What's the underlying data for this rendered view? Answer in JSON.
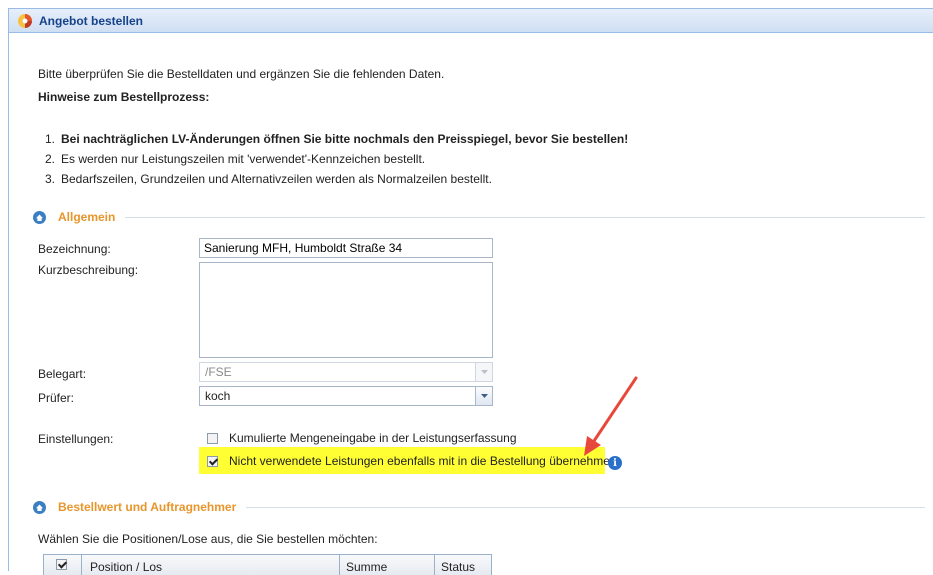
{
  "window": {
    "title": "Angebot bestellen"
  },
  "intro": {
    "text": "Bitte überprüfen Sie die Bestelldaten und ergänzen Sie die fehlenden Daten.",
    "hint_heading": "Hinweise zum Bestellprozess:",
    "hints": [
      {
        "num": "1.",
        "text": "Bei nachträglichen LV-Änderungen öffnen Sie bitte nochmals den Preisspiegel, bevor Sie bestellen!",
        "bold": true
      },
      {
        "num": "2.",
        "text": "Es werden nur Leistungszeilen mit 'verwendet'-Kennzeichen bestellt.",
        "bold": false
      },
      {
        "num": "3.",
        "text": "Bedarfszeilen, Grundzeilen und Alternativzeilen werden als Normalzeilen bestellt.",
        "bold": false
      }
    ]
  },
  "section_general": {
    "title": "Allgemein",
    "bezeichnung_label": "Bezeichnung:",
    "bezeichnung_value": "Sanierung MFH, Humboldt Straße 34",
    "kurzbeschreibung_label": "Kurzbeschreibung:",
    "kurzbeschreibung_value": "",
    "belegart_label": "Belegart:",
    "belegart_value": "/FSE",
    "pruefer_label": "Prüfer:",
    "pruefer_value": "koch",
    "einstellungen_label": "Einstellungen:",
    "option_kumuliert": {
      "label": "Kumulierte Mengeneingabe in der Leistungserfassung",
      "checked": false
    },
    "option_nicht_verwendet": {
      "label": "Nicht verwendete Leistungen ebenfalls mit in die Bestellung übernehmen",
      "checked": true
    }
  },
  "section_order": {
    "title": "Bestellwert und Auftragnehmer",
    "instruction": "Wählen Sie die Positionen/Lose aus, die Sie bestellen möchten:",
    "columns": [
      "Position / Los",
      "Summe",
      "Status"
    ]
  },
  "colors": {
    "highlight": "#ffff33",
    "arrow": "#e8483b",
    "section_title": "#e8962b",
    "title_text": "#15428b"
  }
}
